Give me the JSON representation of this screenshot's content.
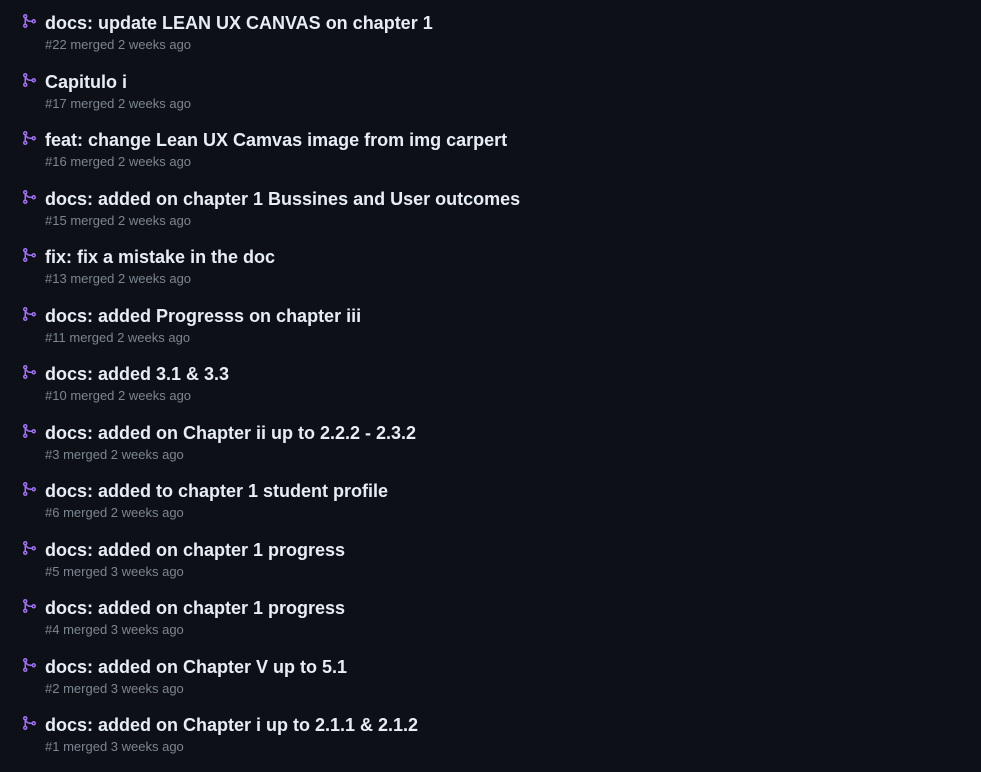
{
  "colors": {
    "background": "#0d1117",
    "title": "#e6edf3",
    "meta": "#7d8590",
    "merged_icon": "#a371f7"
  },
  "icon": "git-merge-icon",
  "pull_requests": [
    {
      "title": "docs: update LEAN UX CANVAS on chapter 1",
      "number": "#22",
      "state": "merged",
      "time": "2 weeks ago"
    },
    {
      "title": "Capitulo i",
      "number": "#17",
      "state": "merged",
      "time": "2 weeks ago"
    },
    {
      "title": "feat: change Lean UX Camvas image from img carpert",
      "number": "#16",
      "state": "merged",
      "time": "2 weeks ago"
    },
    {
      "title": "docs: added on chapter 1 Bussines and User outcomes",
      "number": "#15",
      "state": "merged",
      "time": "2 weeks ago"
    },
    {
      "title": "fix: fix a mistake in the doc",
      "number": "#13",
      "state": "merged",
      "time": "2 weeks ago"
    },
    {
      "title": "docs: added Progresss on chapter iii",
      "number": "#11",
      "state": "merged",
      "time": "2 weeks ago"
    },
    {
      "title": "docs: added 3.1 & 3.3",
      "number": "#10",
      "state": "merged",
      "time": "2 weeks ago"
    },
    {
      "title": "docs: added on Chapter ii up to 2.2.2 - 2.3.2",
      "number": "#3",
      "state": "merged",
      "time": "2 weeks ago"
    },
    {
      "title": "docs: added to chapter 1 student profile",
      "number": "#6",
      "state": "merged",
      "time": "2 weeks ago"
    },
    {
      "title": "docs: added on chapter 1 progress",
      "number": "#5",
      "state": "merged",
      "time": "3 weeks ago"
    },
    {
      "title": "docs: added on chapter 1 progress",
      "number": "#4",
      "state": "merged",
      "time": "3 weeks ago"
    },
    {
      "title": "docs: added on Chapter V up to 5.1",
      "number": "#2",
      "state": "merged",
      "time": "3 weeks ago"
    },
    {
      "title": "docs: added on Chapter i up to 2.1.1 & 2.1.2",
      "number": "#1",
      "state": "merged",
      "time": "3 weeks ago"
    }
  ]
}
